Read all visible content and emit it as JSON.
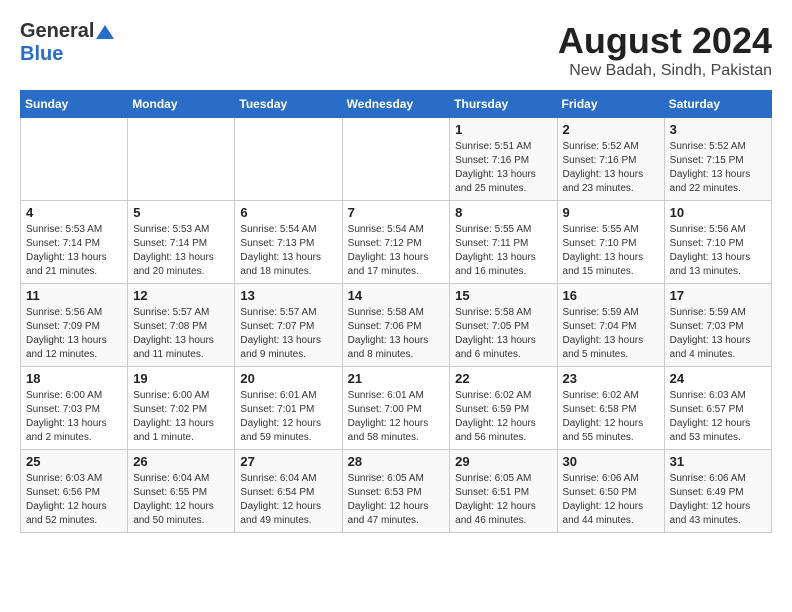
{
  "logo": {
    "general": "General",
    "blue": "Blue"
  },
  "header": {
    "month": "August 2024",
    "location": "New Badah, Sindh, Pakistan"
  },
  "weekdays": [
    "Sunday",
    "Monday",
    "Tuesday",
    "Wednesday",
    "Thursday",
    "Friday",
    "Saturday"
  ],
  "weeks": [
    [
      {
        "day": "",
        "info": ""
      },
      {
        "day": "",
        "info": ""
      },
      {
        "day": "",
        "info": ""
      },
      {
        "day": "",
        "info": ""
      },
      {
        "day": "1",
        "info": "Sunrise: 5:51 AM\nSunset: 7:16 PM\nDaylight: 13 hours\nand 25 minutes."
      },
      {
        "day": "2",
        "info": "Sunrise: 5:52 AM\nSunset: 7:16 PM\nDaylight: 13 hours\nand 23 minutes."
      },
      {
        "day": "3",
        "info": "Sunrise: 5:52 AM\nSunset: 7:15 PM\nDaylight: 13 hours\nand 22 minutes."
      }
    ],
    [
      {
        "day": "4",
        "info": "Sunrise: 5:53 AM\nSunset: 7:14 PM\nDaylight: 13 hours\nand 21 minutes."
      },
      {
        "day": "5",
        "info": "Sunrise: 5:53 AM\nSunset: 7:14 PM\nDaylight: 13 hours\nand 20 minutes."
      },
      {
        "day": "6",
        "info": "Sunrise: 5:54 AM\nSunset: 7:13 PM\nDaylight: 13 hours\nand 18 minutes."
      },
      {
        "day": "7",
        "info": "Sunrise: 5:54 AM\nSunset: 7:12 PM\nDaylight: 13 hours\nand 17 minutes."
      },
      {
        "day": "8",
        "info": "Sunrise: 5:55 AM\nSunset: 7:11 PM\nDaylight: 13 hours\nand 16 minutes."
      },
      {
        "day": "9",
        "info": "Sunrise: 5:55 AM\nSunset: 7:10 PM\nDaylight: 13 hours\nand 15 minutes."
      },
      {
        "day": "10",
        "info": "Sunrise: 5:56 AM\nSunset: 7:10 PM\nDaylight: 13 hours\nand 13 minutes."
      }
    ],
    [
      {
        "day": "11",
        "info": "Sunrise: 5:56 AM\nSunset: 7:09 PM\nDaylight: 13 hours\nand 12 minutes."
      },
      {
        "day": "12",
        "info": "Sunrise: 5:57 AM\nSunset: 7:08 PM\nDaylight: 13 hours\nand 11 minutes."
      },
      {
        "day": "13",
        "info": "Sunrise: 5:57 AM\nSunset: 7:07 PM\nDaylight: 13 hours\nand 9 minutes."
      },
      {
        "day": "14",
        "info": "Sunrise: 5:58 AM\nSunset: 7:06 PM\nDaylight: 13 hours\nand 8 minutes."
      },
      {
        "day": "15",
        "info": "Sunrise: 5:58 AM\nSunset: 7:05 PM\nDaylight: 13 hours\nand 6 minutes."
      },
      {
        "day": "16",
        "info": "Sunrise: 5:59 AM\nSunset: 7:04 PM\nDaylight: 13 hours\nand 5 minutes."
      },
      {
        "day": "17",
        "info": "Sunrise: 5:59 AM\nSunset: 7:03 PM\nDaylight: 13 hours\nand 4 minutes."
      }
    ],
    [
      {
        "day": "18",
        "info": "Sunrise: 6:00 AM\nSunset: 7:03 PM\nDaylight: 13 hours\nand 2 minutes."
      },
      {
        "day": "19",
        "info": "Sunrise: 6:00 AM\nSunset: 7:02 PM\nDaylight: 13 hours\nand 1 minute."
      },
      {
        "day": "20",
        "info": "Sunrise: 6:01 AM\nSunset: 7:01 PM\nDaylight: 12 hours\nand 59 minutes."
      },
      {
        "day": "21",
        "info": "Sunrise: 6:01 AM\nSunset: 7:00 PM\nDaylight: 12 hours\nand 58 minutes."
      },
      {
        "day": "22",
        "info": "Sunrise: 6:02 AM\nSunset: 6:59 PM\nDaylight: 12 hours\nand 56 minutes."
      },
      {
        "day": "23",
        "info": "Sunrise: 6:02 AM\nSunset: 6:58 PM\nDaylight: 12 hours\nand 55 minutes."
      },
      {
        "day": "24",
        "info": "Sunrise: 6:03 AM\nSunset: 6:57 PM\nDaylight: 12 hours\nand 53 minutes."
      }
    ],
    [
      {
        "day": "25",
        "info": "Sunrise: 6:03 AM\nSunset: 6:56 PM\nDaylight: 12 hours\nand 52 minutes."
      },
      {
        "day": "26",
        "info": "Sunrise: 6:04 AM\nSunset: 6:55 PM\nDaylight: 12 hours\nand 50 minutes."
      },
      {
        "day": "27",
        "info": "Sunrise: 6:04 AM\nSunset: 6:54 PM\nDaylight: 12 hours\nand 49 minutes."
      },
      {
        "day": "28",
        "info": "Sunrise: 6:05 AM\nSunset: 6:53 PM\nDaylight: 12 hours\nand 47 minutes."
      },
      {
        "day": "29",
        "info": "Sunrise: 6:05 AM\nSunset: 6:51 PM\nDaylight: 12 hours\nand 46 minutes."
      },
      {
        "day": "30",
        "info": "Sunrise: 6:06 AM\nSunset: 6:50 PM\nDaylight: 12 hours\nand 44 minutes."
      },
      {
        "day": "31",
        "info": "Sunrise: 6:06 AM\nSunset: 6:49 PM\nDaylight: 12 hours\nand 43 minutes."
      }
    ]
  ]
}
